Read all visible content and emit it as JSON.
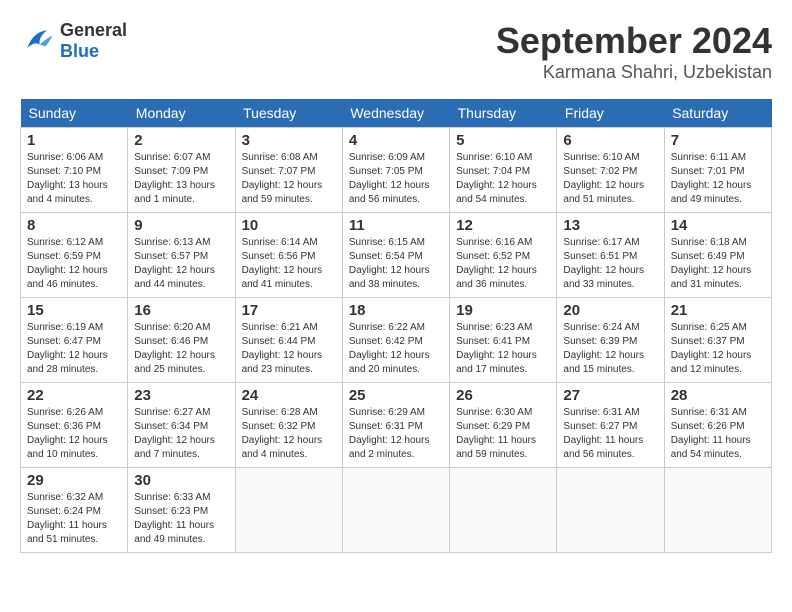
{
  "logo": {
    "text_general": "General",
    "text_blue": "Blue"
  },
  "title": {
    "month": "September 2024",
    "location": "Karmana Shahri, Uzbekistan"
  },
  "headers": [
    "Sunday",
    "Monday",
    "Tuesday",
    "Wednesday",
    "Thursday",
    "Friday",
    "Saturday"
  ],
  "weeks": [
    [
      {
        "day": "1",
        "info": "Sunrise: 6:06 AM\nSunset: 7:10 PM\nDaylight: 13 hours\nand 4 minutes."
      },
      {
        "day": "2",
        "info": "Sunrise: 6:07 AM\nSunset: 7:09 PM\nDaylight: 13 hours\nand 1 minute."
      },
      {
        "day": "3",
        "info": "Sunrise: 6:08 AM\nSunset: 7:07 PM\nDaylight: 12 hours\nand 59 minutes."
      },
      {
        "day": "4",
        "info": "Sunrise: 6:09 AM\nSunset: 7:05 PM\nDaylight: 12 hours\nand 56 minutes."
      },
      {
        "day": "5",
        "info": "Sunrise: 6:10 AM\nSunset: 7:04 PM\nDaylight: 12 hours\nand 54 minutes."
      },
      {
        "day": "6",
        "info": "Sunrise: 6:10 AM\nSunset: 7:02 PM\nDaylight: 12 hours\nand 51 minutes."
      },
      {
        "day": "7",
        "info": "Sunrise: 6:11 AM\nSunset: 7:01 PM\nDaylight: 12 hours\nand 49 minutes."
      }
    ],
    [
      {
        "day": "8",
        "info": "Sunrise: 6:12 AM\nSunset: 6:59 PM\nDaylight: 12 hours\nand 46 minutes."
      },
      {
        "day": "9",
        "info": "Sunrise: 6:13 AM\nSunset: 6:57 PM\nDaylight: 12 hours\nand 44 minutes."
      },
      {
        "day": "10",
        "info": "Sunrise: 6:14 AM\nSunset: 6:56 PM\nDaylight: 12 hours\nand 41 minutes."
      },
      {
        "day": "11",
        "info": "Sunrise: 6:15 AM\nSunset: 6:54 PM\nDaylight: 12 hours\nand 38 minutes."
      },
      {
        "day": "12",
        "info": "Sunrise: 6:16 AM\nSunset: 6:52 PM\nDaylight: 12 hours\nand 36 minutes."
      },
      {
        "day": "13",
        "info": "Sunrise: 6:17 AM\nSunset: 6:51 PM\nDaylight: 12 hours\nand 33 minutes."
      },
      {
        "day": "14",
        "info": "Sunrise: 6:18 AM\nSunset: 6:49 PM\nDaylight: 12 hours\nand 31 minutes."
      }
    ],
    [
      {
        "day": "15",
        "info": "Sunrise: 6:19 AM\nSunset: 6:47 PM\nDaylight: 12 hours\nand 28 minutes."
      },
      {
        "day": "16",
        "info": "Sunrise: 6:20 AM\nSunset: 6:46 PM\nDaylight: 12 hours\nand 25 minutes."
      },
      {
        "day": "17",
        "info": "Sunrise: 6:21 AM\nSunset: 6:44 PM\nDaylight: 12 hours\nand 23 minutes."
      },
      {
        "day": "18",
        "info": "Sunrise: 6:22 AM\nSunset: 6:42 PM\nDaylight: 12 hours\nand 20 minutes."
      },
      {
        "day": "19",
        "info": "Sunrise: 6:23 AM\nSunset: 6:41 PM\nDaylight: 12 hours\nand 17 minutes."
      },
      {
        "day": "20",
        "info": "Sunrise: 6:24 AM\nSunset: 6:39 PM\nDaylight: 12 hours\nand 15 minutes."
      },
      {
        "day": "21",
        "info": "Sunrise: 6:25 AM\nSunset: 6:37 PM\nDaylight: 12 hours\nand 12 minutes."
      }
    ],
    [
      {
        "day": "22",
        "info": "Sunrise: 6:26 AM\nSunset: 6:36 PM\nDaylight: 12 hours\nand 10 minutes."
      },
      {
        "day": "23",
        "info": "Sunrise: 6:27 AM\nSunset: 6:34 PM\nDaylight: 12 hours\nand 7 minutes."
      },
      {
        "day": "24",
        "info": "Sunrise: 6:28 AM\nSunset: 6:32 PM\nDaylight: 12 hours\nand 4 minutes."
      },
      {
        "day": "25",
        "info": "Sunrise: 6:29 AM\nSunset: 6:31 PM\nDaylight: 12 hours\nand 2 minutes."
      },
      {
        "day": "26",
        "info": "Sunrise: 6:30 AM\nSunset: 6:29 PM\nDaylight: 11 hours\nand 59 minutes."
      },
      {
        "day": "27",
        "info": "Sunrise: 6:31 AM\nSunset: 6:27 PM\nDaylight: 11 hours\nand 56 minutes."
      },
      {
        "day": "28",
        "info": "Sunrise: 6:31 AM\nSunset: 6:26 PM\nDaylight: 11 hours\nand 54 minutes."
      }
    ],
    [
      {
        "day": "29",
        "info": "Sunrise: 6:32 AM\nSunset: 6:24 PM\nDaylight: 11 hours\nand 51 minutes."
      },
      {
        "day": "30",
        "info": "Sunrise: 6:33 AM\nSunset: 6:23 PM\nDaylight: 11 hours\nand 49 minutes."
      },
      {
        "day": "",
        "info": ""
      },
      {
        "day": "",
        "info": ""
      },
      {
        "day": "",
        "info": ""
      },
      {
        "day": "",
        "info": ""
      },
      {
        "day": "",
        "info": ""
      }
    ]
  ]
}
